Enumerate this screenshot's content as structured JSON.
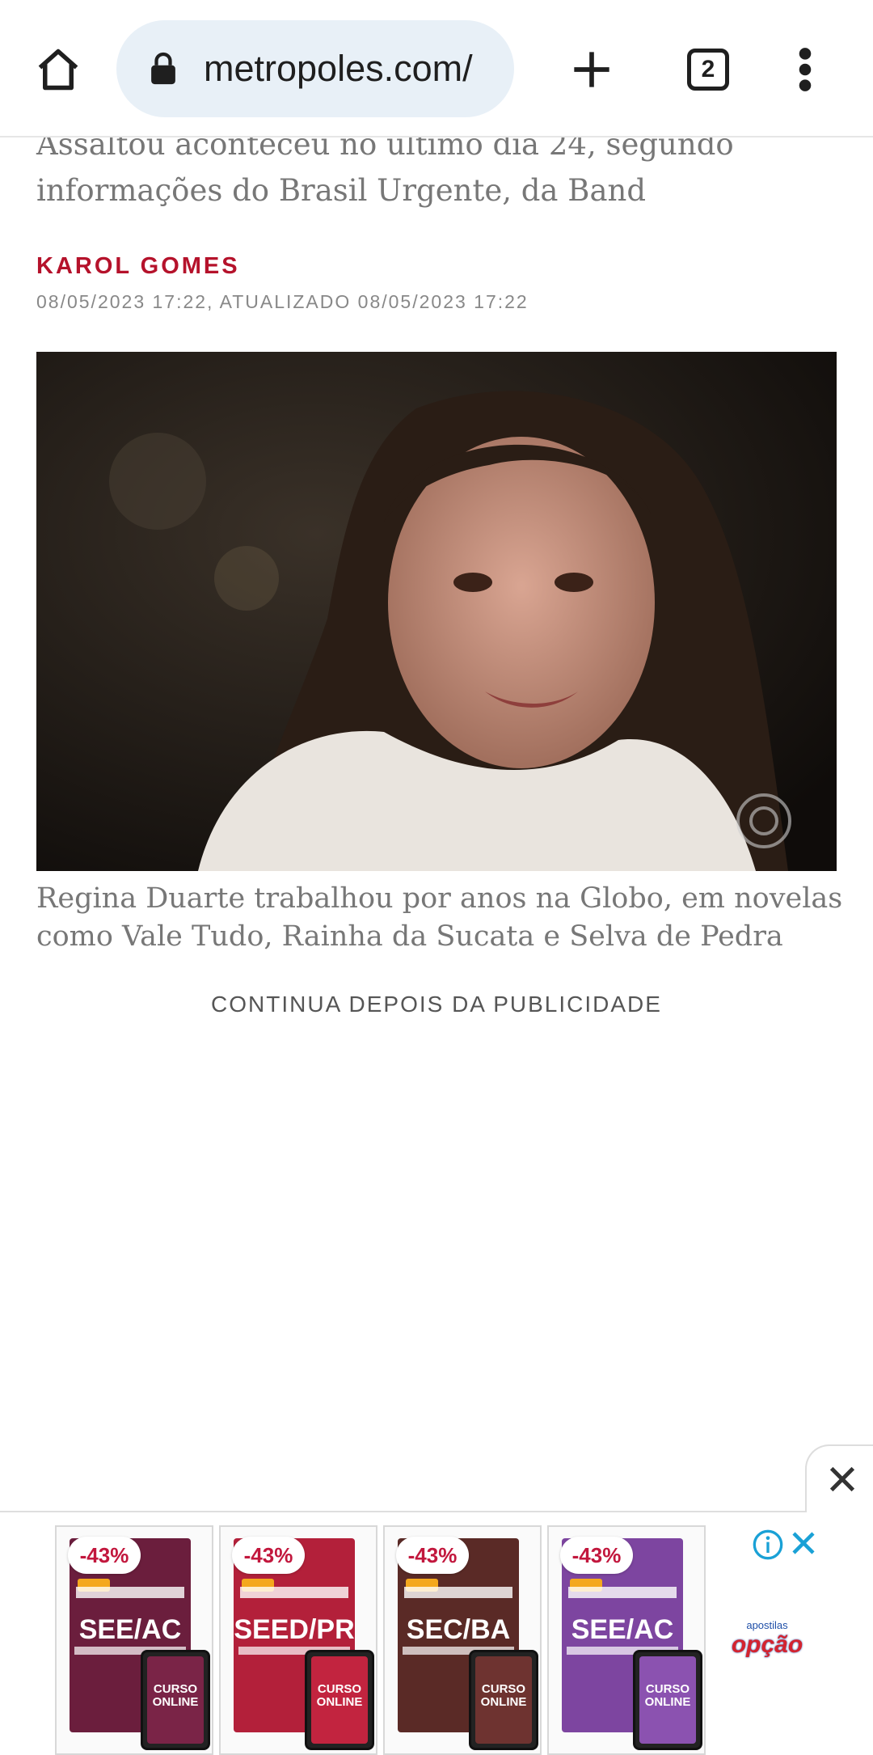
{
  "browser": {
    "url": "metropoles.com/",
    "tab_count": "2",
    "icons": [
      "home-icon",
      "lock-icon",
      "new-tab-plus-icon",
      "tab-switcher-icon",
      "overflow-menu-icon"
    ]
  },
  "article": {
    "dek": "Assaltou aconteceu no último dia 24, segundo informações do Brasil Urgente, da Band",
    "author": "KAROL GOMES",
    "date": "08/05/2023 17:22, ATUALIZADO 08/05/2023 17:22",
    "photo_caption": "Regina Duarte trabalhou por anos na Globo, em novelas como Vale Tudo, Rainha da Sucata e Selva de Pedra",
    "ad_notice": "CONTINUA DEPOIS DA PUBLICIDADE"
  },
  "ad": {
    "products": [
      {
        "discount": "-43%",
        "code": "SEE/AC",
        "badge": "CURSO ONLINE",
        "color": "#6b1e3d",
        "tablet_color": "#7a2447"
      },
      {
        "discount": "-43%",
        "code": "SEED/PR",
        "badge": "CURSO ONLINE",
        "color": "#b3203a",
        "tablet_color": "#c2243f"
      },
      {
        "discount": "-43%",
        "code": "SEC/BA",
        "badge": "CURSO ONLINE",
        "color": "#5a2a26",
        "tablet_color": "#6e3330"
      },
      {
        "discount": "-43%",
        "code": "SEE/AC",
        "badge": "CURSO ONLINE",
        "color": "#7d45a0",
        "tablet_color": "#8b52b0"
      }
    ],
    "brand_small": "apostilas",
    "brand_big": "opção"
  },
  "colors": {
    "accent": "#b5122b",
    "urlbar": "#e8f0f7"
  }
}
